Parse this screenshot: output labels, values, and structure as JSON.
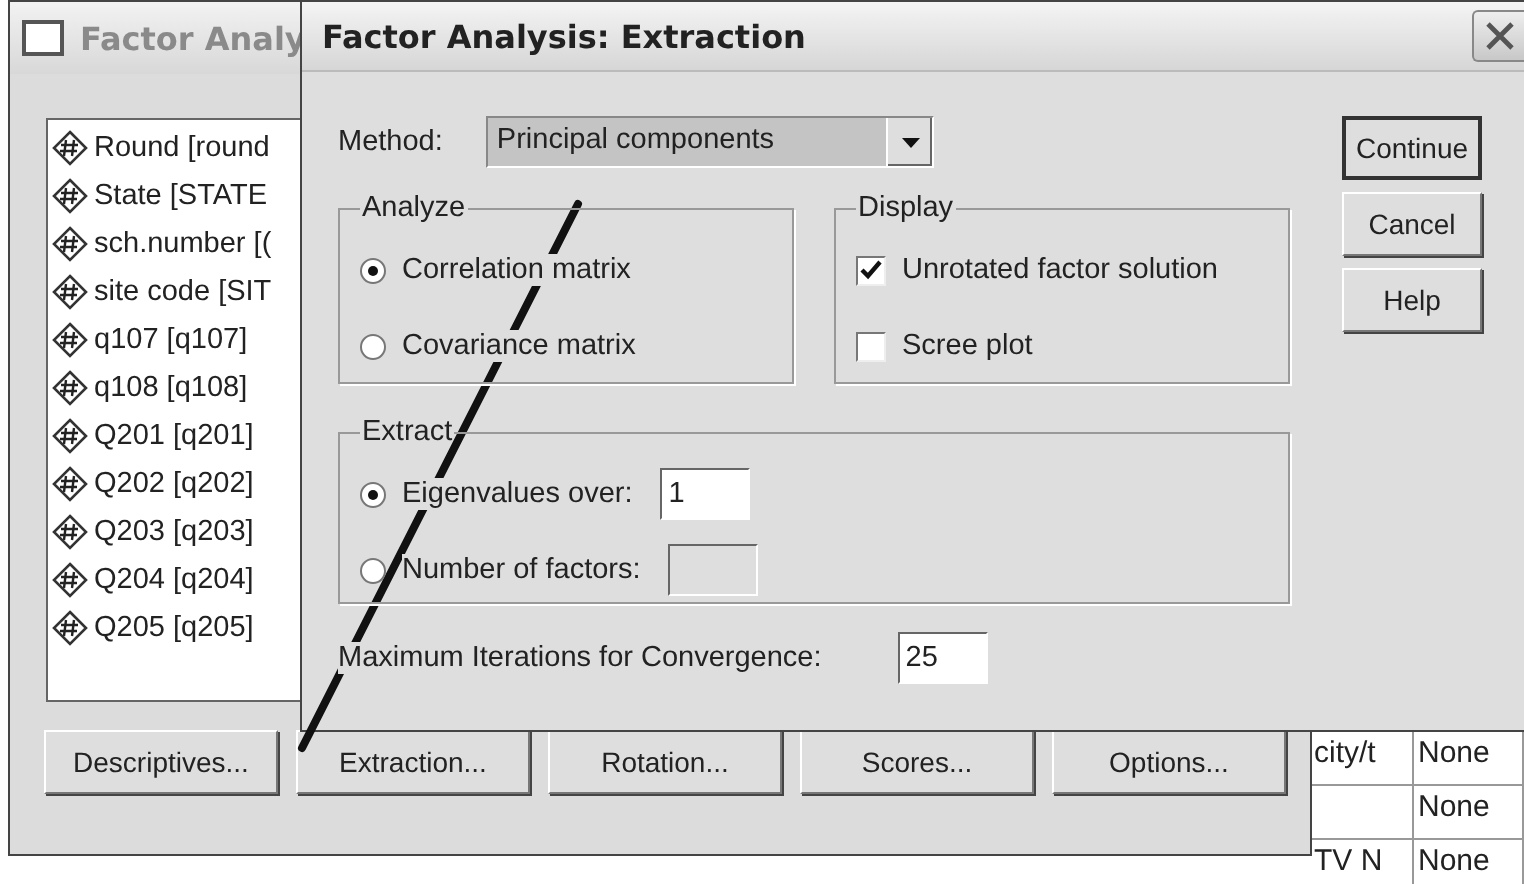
{
  "data_grid": {
    "rows": [
      {
        "column_1": "city/t",
        "column_2": "None"
      },
      {
        "column_2": "None"
      },
      {
        "column_1": "TV N",
        "column_2": "None"
      }
    ]
  },
  "background_window": {
    "title": "Factor Analy",
    "variables": [
      "Round [round",
      "State [STATE",
      "sch.number [(",
      "site code [SIT",
      "q107 [q107]",
      "q108 [q108]",
      "Q201 [q201]",
      "Q202 [q202]",
      "Q203 [q203]",
      "Q204 [q204]",
      "Q205 [q205]"
    ],
    "buttons": [
      "Descriptives...",
      "Extraction...",
      "Rotation...",
      "Scores...",
      "Options..."
    ]
  },
  "dialog": {
    "title": "Factor Analysis: Extraction",
    "method": {
      "label": "Method:",
      "value": "Principal components"
    },
    "analyze": {
      "title": "Analyze",
      "options": [
        {
          "label": "Correlation matrix",
          "selected": true
        },
        {
          "label": "Covariance matrix",
          "selected": false
        }
      ]
    },
    "display": {
      "title": "Display",
      "options": [
        {
          "label": "Unrotated factor solution",
          "checked": true
        },
        {
          "label": "Scree plot",
          "checked": false
        }
      ]
    },
    "extract": {
      "title": "Extract",
      "options": [
        {
          "label": "Eigenvalues over:",
          "selected": true,
          "value": "1",
          "disabled": false
        },
        {
          "label": "Number of factors:",
          "selected": false,
          "disabled": true
        }
      ]
    },
    "iterations": {
      "label": "Maximum Iterations for Convergence:",
      "value": "25"
    },
    "buttons": [
      {
        "label": "Continue",
        "default": true
      },
      {
        "label": "Cancel",
        "default": false
      },
      {
        "label": "Help",
        "default": false
      }
    ]
  }
}
